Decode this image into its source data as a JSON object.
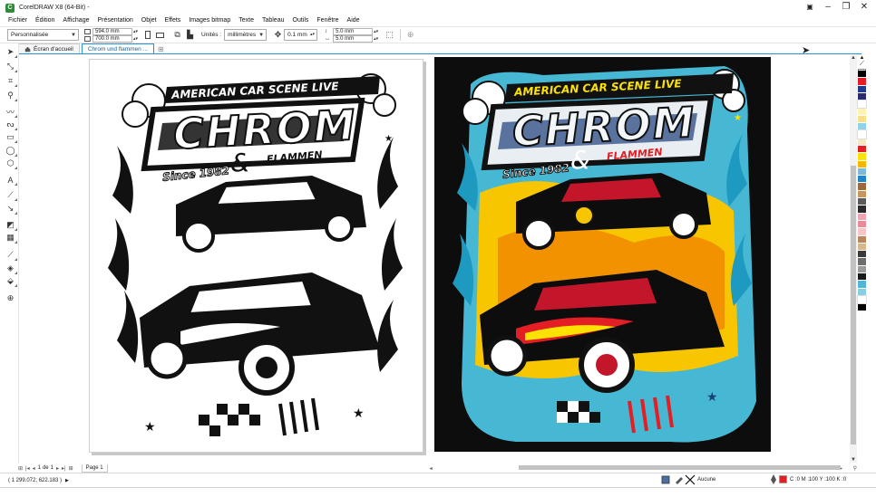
{
  "window": {
    "title": "CorelDRAW X8 (64-Bit) -",
    "controls": [
      "minimize",
      "restore",
      "close"
    ]
  },
  "menu": [
    "Fichier",
    "Édition",
    "Affichage",
    "Présentation",
    "Objet",
    "Effets",
    "Images bitmap",
    "Texte",
    "Tableau",
    "Outils",
    "Fenêtre",
    "Aide"
  ],
  "propbar": {
    "page_preset": "Personnalisée",
    "width": "594.0 mm",
    "height": "700.0 mm",
    "units_label": "Unités :",
    "units_value": "millimètres",
    "nudge": "0.1 mm",
    "dup_x": "5.0 mm",
    "dup_y": "5.0 mm"
  },
  "doc_tabs": [
    {
      "label": "Écran d'accueil",
      "active": false
    },
    {
      "label": "Chrom und flammen ...",
      "active": true
    }
  ],
  "artwork": {
    "headline": "AMERICAN CAR SCENE LIVE",
    "logo": "CHROM",
    "connector": "&",
    "subtitle": "FLAMMEN",
    "since": "Since 1982"
  },
  "palette_colors": [
    "#000000",
    "#e31e24",
    "#1f3b8f",
    "#2a2a72",
    "#ffffff",
    "#fff2b3",
    "#f7e08a",
    "#8fd3e8",
    "#ffffff",
    "#f5e6c8",
    "#e31e24",
    "#fce200",
    "#f7b500",
    "#7fb8d9",
    "#1d86c8",
    "#9b6a3c",
    "#c8965a",
    "#5a5a5a",
    "#2b2b2b",
    "#f2a6b5",
    "#e88a9a",
    "#f7c7c7",
    "#b8865a",
    "#d8b88a",
    "#3a3a3a",
    "#6d6d6d",
    "#9a9a9a",
    "#1a1a1a",
    "#4fb6d6",
    "#88cfe3",
    "#ffffff",
    "#000000"
  ],
  "pagenav": {
    "current": "1",
    "of_label": "de",
    "total": "1",
    "page_tab": "Page 1"
  },
  "status": {
    "coords": "( 1 299.072; 622.183 )",
    "fill_label": "Aucune",
    "outline_color": "#e31e24",
    "outline_value": "C :0 M :100 Y :100 K :0"
  }
}
